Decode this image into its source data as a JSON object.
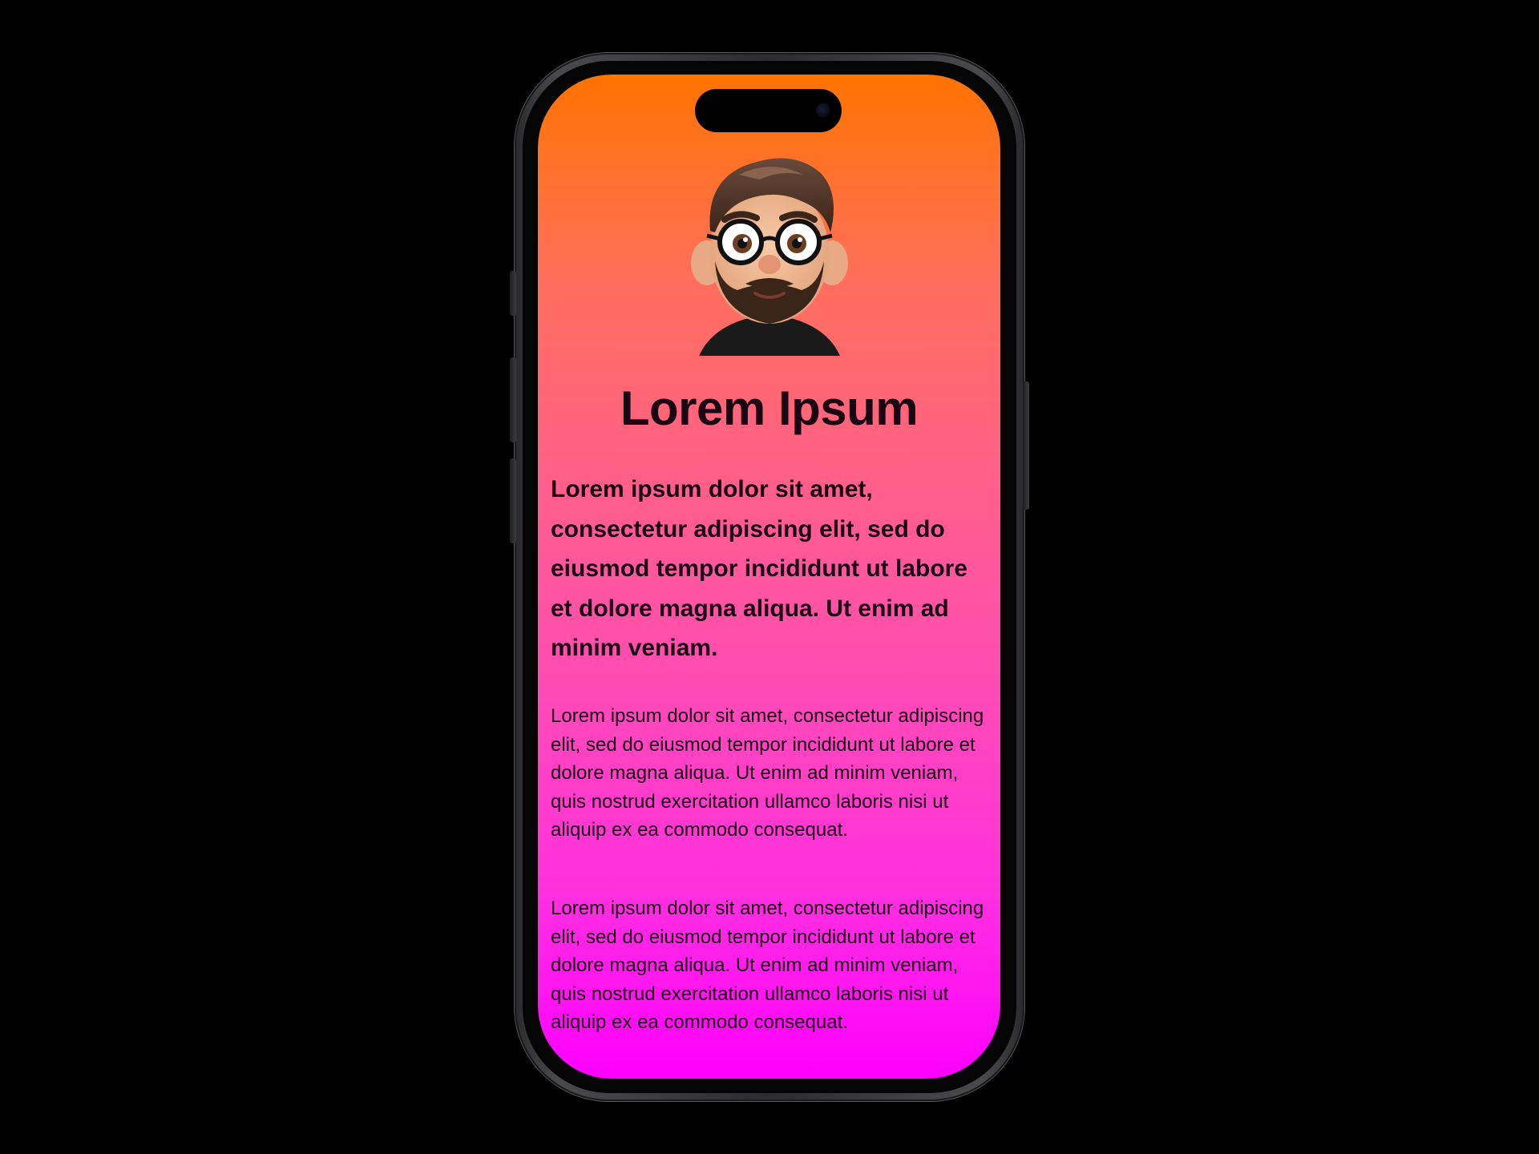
{
  "profile": {
    "title": "Lorem Ipsum",
    "lead": "Lorem ipsum dolor sit amet, consectetur adipiscing elit, sed do eiusmod tempor incididunt ut labore et dolore magna aliqua. Ut enim ad minim veniam.",
    "paragraphs": [
      "Lorem ipsum dolor sit amet, consectetur adipiscing elit, sed do eiusmod tempor incididunt ut labore et dolore magna aliqua. Ut enim ad minim veniam, quis nostrud exercitation ullamco laboris nisi ut aliquip ex ea commodo consequat.",
      "Lorem ipsum dolor sit amet, consectetur adipiscing elit, sed do eiusmod tempor incididunt ut labore et dolore magna aliqua. Ut enim ad minim veniam, quis nostrud exercitation ullamco laboris nisi ut aliquip ex ea commodo consequat."
    ],
    "avatar_icon": "memoji-avatar-icon"
  },
  "colors": {
    "gradient_top": "#ff7300",
    "gradient_bottom": "#ff00ff",
    "text": "#1a0514",
    "background": "#000000"
  }
}
